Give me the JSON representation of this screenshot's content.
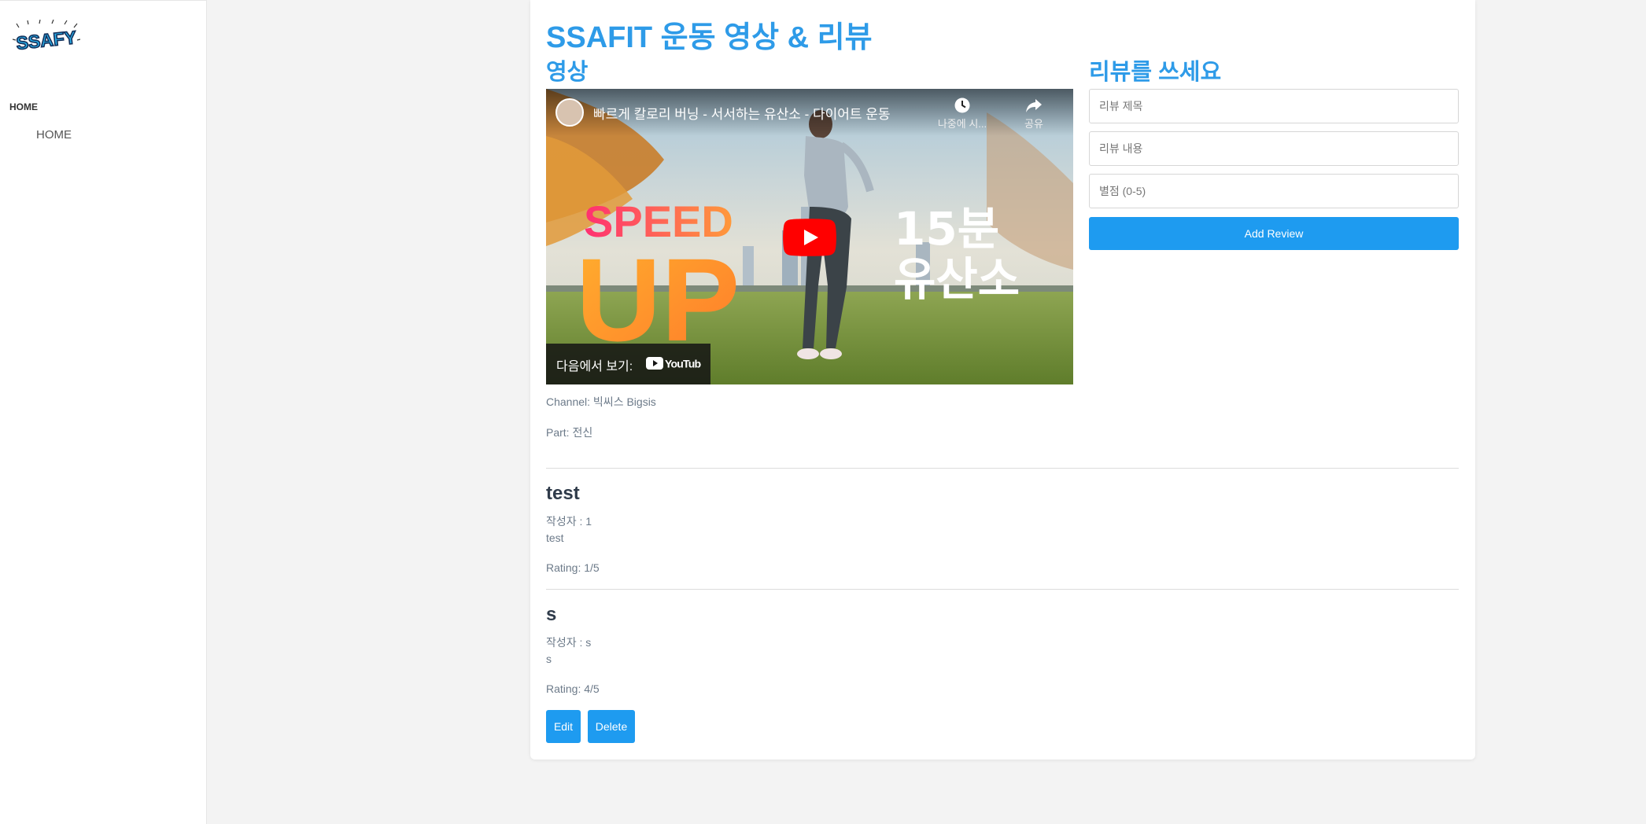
{
  "sidebar": {
    "logo_text": "SSAFY",
    "section_label": "HOME",
    "items": [
      {
        "label": "HOME"
      }
    ]
  },
  "main": {
    "title": "SSAFIT 운동 영상 & 리뷰",
    "video_section_title": "영상",
    "review_section_title": "리뷰를 쓰세요"
  },
  "video": {
    "title": "빠르게 칼로리 버닝 - 서서하는 유산소 - 다이어트 운동",
    "watch_later_label": "나중에 시...",
    "share_label": "공유",
    "watch_on_label": "다음에서 보기:",
    "youtube_label": "YouTube",
    "thumb_text_speed": "SPEED",
    "thumb_text_up": "UP",
    "thumb_text_15": "15분",
    "thumb_text_cardio": "유산소"
  },
  "details": {
    "channel": "Channel: 빅씨스 Bigsis",
    "part": "Part: 전신"
  },
  "form": {
    "title_placeholder": "리뷰 제목",
    "content_placeholder": "리뷰 내용",
    "rating_placeholder": "별점 (0-5)",
    "submit_label": "Add Review"
  },
  "reviews": [
    {
      "title": "test",
      "author": "작성자 : 1",
      "content": "test",
      "rating": "Rating: 1/5"
    },
    {
      "title": "s",
      "author": "작성자 : s",
      "content": "s",
      "rating": "Rating: 4/5"
    }
  ],
  "actions": {
    "edit_label": "Edit",
    "delete_label": "Delete"
  },
  "colors": {
    "accent": "#2e9be8",
    "button": "#1e9bf0",
    "youtube_red": "#ff0000"
  }
}
